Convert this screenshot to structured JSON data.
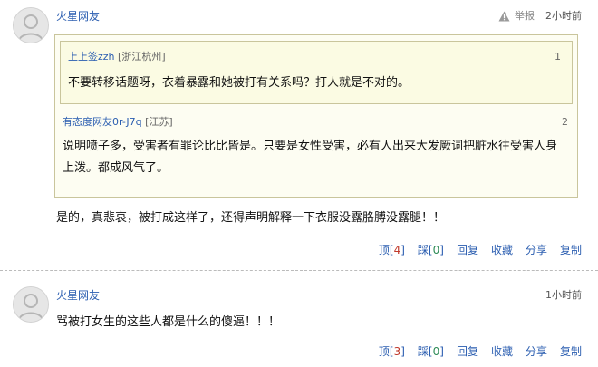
{
  "comments": [
    {
      "username": "火星网友",
      "report_label": "举报",
      "time": "2小时前",
      "quotes": [
        {
          "num": "1",
          "user": "上上签zzh",
          "loc": "[浙江杭州]",
          "text": "不要转移话题呀，衣着暴露和她被打有关系吗？打人就是不对的。"
        },
        {
          "num": "2",
          "user": "有态度网友0r-J7q",
          "loc": "[江苏]",
          "text_line1": "说明喷子多，受害者有罪论比比皆是。只要是女性受害，必有人出来大发厥词把脏水往受害人身",
          "text_line2": "上泼。都成风气了。"
        }
      ],
      "text": "是的，真悲哀，被打成这样了，还得声明解释一下衣服没露胳膊没露腿！！",
      "actions": {
        "up_label": "顶",
        "up_count": "4",
        "down_label": "踩",
        "down_count": "0",
        "reply": "回复",
        "favorite": "收藏",
        "share": "分享",
        "copy": "复制"
      }
    },
    {
      "username": "火星网友",
      "time": "1小时前",
      "text": "骂被打女生的这些人都是什么的傻逼！！！",
      "actions": {
        "up_label": "顶",
        "up_count": "3",
        "down_label": "踩",
        "down_count": "0",
        "reply": "回复",
        "favorite": "收藏",
        "share": "分享",
        "copy": "复制"
      }
    }
  ],
  "colors": {
    "link": "#2a5db0",
    "up_count": "#c0392b",
    "down_count": "#2e8b57",
    "quote_bg": "#fbfbe3",
    "quote_border": "#c9c59c"
  }
}
